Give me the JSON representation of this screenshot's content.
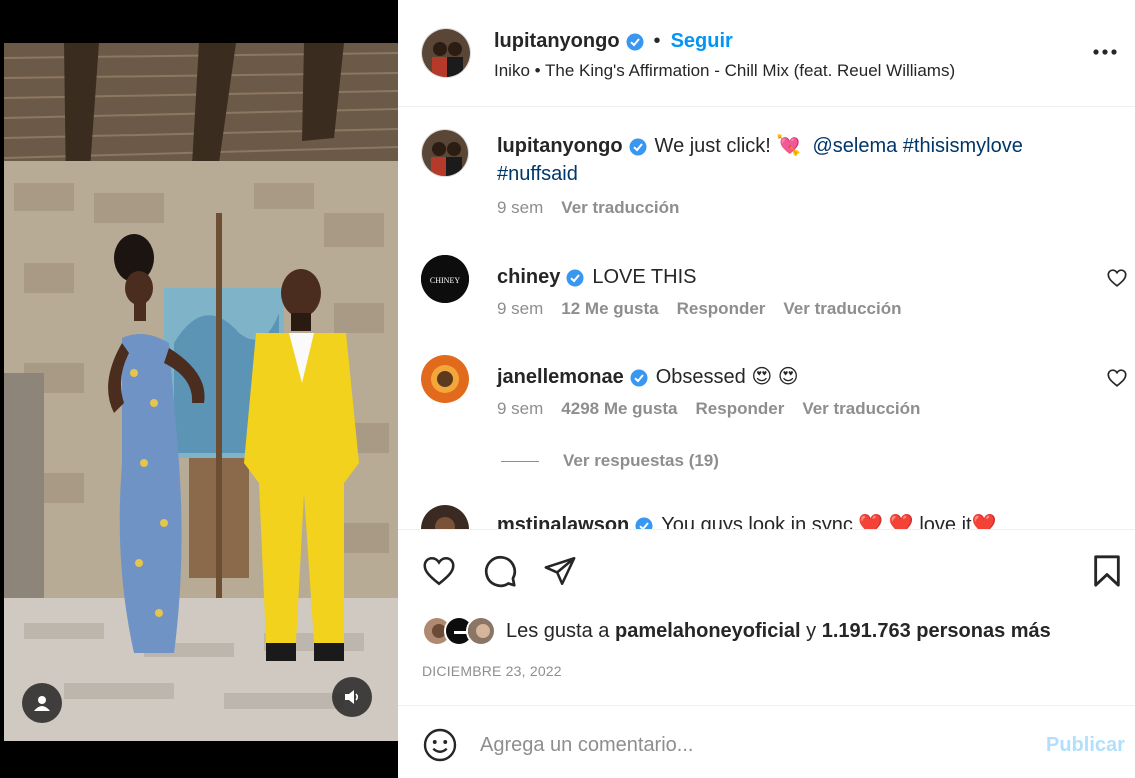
{
  "post": {
    "username": "lupitanyongo",
    "follow_label": "Seguir",
    "audio": "Iniko • The King's Affirmation - Chill Mix (feat. Reuel Williams)",
    "caption": {
      "username": "lupitanyongo",
      "text": "We just click! 💘",
      "mention": "@selema",
      "tag1": "#thisismylove",
      "tag2": "#nuffsaid",
      "time": "9 sem",
      "translate": "Ver traducción"
    }
  },
  "comments": [
    {
      "username": "chiney",
      "text": "LOVE THIS",
      "time": "9 sem",
      "likes": "12 Me gusta",
      "reply": "Responder",
      "translate": "Ver traducción",
      "avatar_text": "CHINEY"
    },
    {
      "username": "janellemonae",
      "text": "Obsessed 😍 😍",
      "time": "9 sem",
      "likes": "4298 Me gusta",
      "reply": "Responder",
      "translate": "Ver traducción",
      "replies_label": "Ver respuestas (19)"
    },
    {
      "username": "mstinalawson",
      "text": "You guys look in sync ❤️ ❤️ love it❤️"
    }
  ],
  "actions": {
    "likes_prefix": "Les gusta a",
    "liker": "pamelahoneyoficial",
    "likes_mid": "y",
    "likes_count": "1.191.763 personas más",
    "date": "DICIEMBRE 23, 2022"
  },
  "composer": {
    "placeholder": "Agrega un comentario...",
    "publish_label": "Publicar"
  },
  "colors": {
    "accent": "#0095f6",
    "publish_disabled": "#b2dffc",
    "verified": "#3897f0",
    "suit": "#f2d21c"
  },
  "icons": [
    "verified-icon",
    "more-icon",
    "heart-icon",
    "comment-icon",
    "share-icon",
    "bookmark-icon",
    "emoji-icon",
    "user-tag-icon",
    "audio-icon"
  ]
}
